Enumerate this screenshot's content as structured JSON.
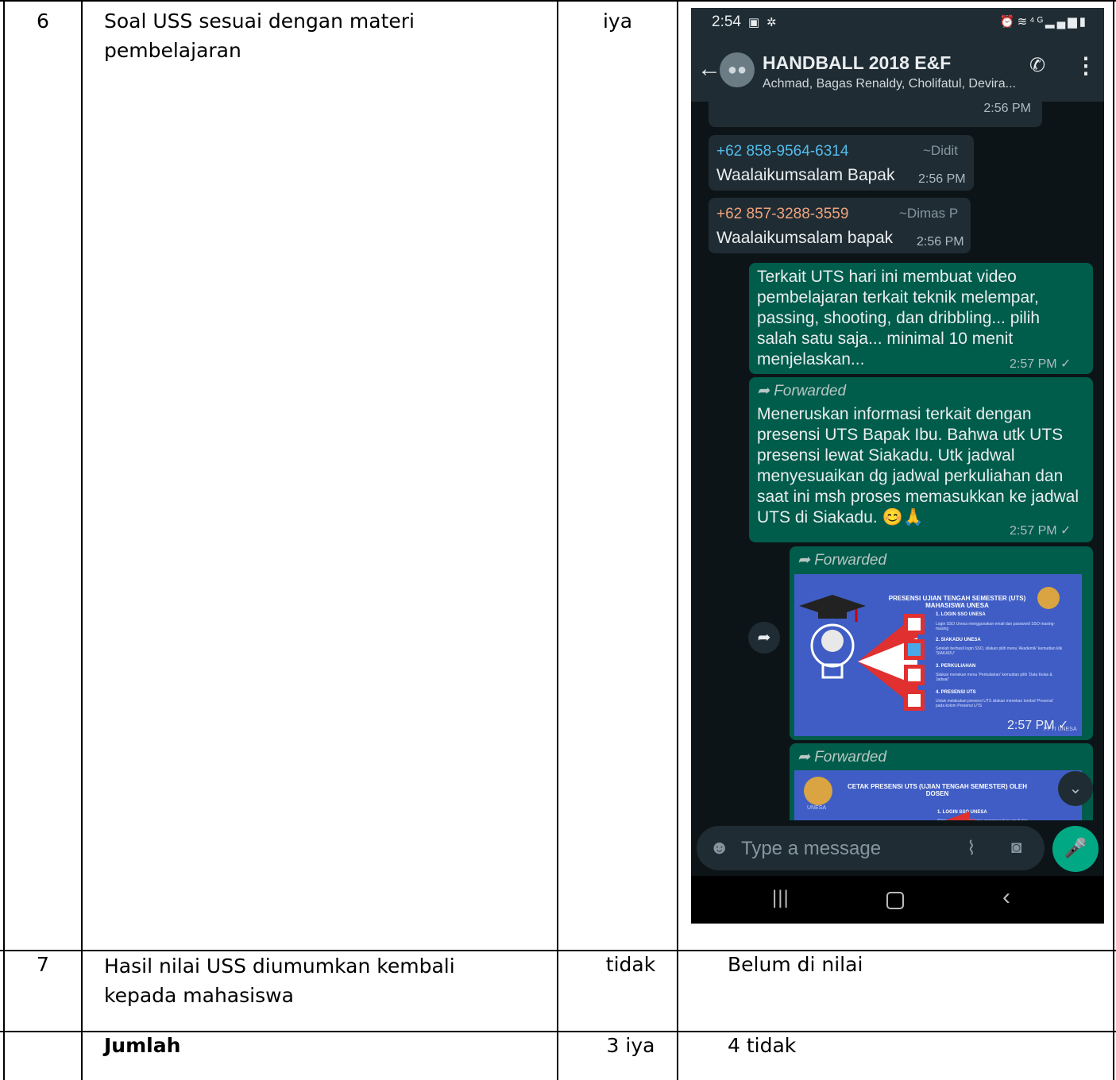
{
  "table": {
    "rows": [
      {
        "no": "6",
        "item": "Soal USS sesuai dengan materi pembelajaran",
        "status": "iya",
        "note": ""
      },
      {
        "no": "7",
        "item": "Hasil nilai USS diumumkan kembali kepada mahasiswa",
        "status": "tidak",
        "note": "Belum di nilai"
      },
      {
        "no": "",
        "item": "Jumlah",
        "status": "3 iya",
        "note": "4 tidak"
      }
    ]
  },
  "phone": {
    "status_bar": {
      "time": "2:54",
      "icons": [
        "gallery-icon",
        "gear-icon",
        "alarm-icon",
        "wifi-icon",
        "4g-icon",
        "signal-icon",
        "battery-icon"
      ]
    },
    "chat_header": {
      "group_name": "HANDBALL 2018 E&F",
      "members": "Achmad, Bagas Renaldy, Cholifatul, Devira..."
    },
    "messages": [
      {
        "type": "in",
        "time": "2:56 PM"
      },
      {
        "type": "in",
        "sender": "+62 858-9564-6314",
        "alias": "~Didit",
        "text": "Waalaikumsalam Bapak",
        "time": "2:56 PM",
        "sender_color": "#53bdeb"
      },
      {
        "type": "in",
        "sender": "+62 857-3288-3559",
        "alias": "~Dimas P",
        "text": "Waalaikumsalam bapak",
        "time": "2:56 PM",
        "sender_color": "#f0a37d"
      },
      {
        "type": "out",
        "text": "Terkait UTS hari ini membuat video pembelajaran terkait teknik melempar, passing, shooting, dan dribbling... pilih salah satu saja... minimal 10 menit menjelaskan...",
        "time": "2:57 PM ✓"
      },
      {
        "type": "out",
        "forwarded": "Forwarded",
        "text": "Meneruskan informasi terkait dengan presensi UTS Bapak Ibu. Bahwa utk UTS presensi lewat Siakadu. Utk jadwal menyesuaikan dg jadwal perkuliahan dan saat ini msh proses memasukkan ke jadwal UTS di Siakadu. 😊🙏",
        "time": "2:57 PM ✓"
      },
      {
        "type": "out-image",
        "forwarded": "Forwarded",
        "time": "2:57 PM ✓",
        "poster": {
          "title": "PRESENSI UJIAN TENGAH SEMESTER (UTS) MAHASISWA UNESA",
          "items": [
            {
              "heading": "1. LOGIN SSO UNESA",
              "desc": "Login SSO Unesa menggunakan email dan password SSO masing-masing"
            },
            {
              "heading": "2. SIAKADU UNESA",
              "desc": "Setelah berhasil login SSO, silakan pilih menu 'Akademik' kemudian klik 'SIAKADU'"
            },
            {
              "heading": "3. PERKULIAHAN",
              "desc": "Silakan menekan menu 'Perkuliahan' kemudian pilih 'Data Kelas & Jadwal'"
            },
            {
              "heading": "4. PRESENSI UTS",
              "desc": "Untuk melakukan presensi UTS silakan menekan tombol 'Presensi' pada kolom Presensi UTS"
            }
          ],
          "footer": "PPTI UNESA"
        }
      },
      {
        "type": "out-image",
        "forwarded": "Forwarded",
        "poster": {
          "title": "CETAK PRESENSI UTS (UJIAN TENGAH SEMESTER) OLEH DOSEN",
          "items": [
            {
              "heading": "1. LOGIN SSO UNESA",
              "desc": "Silakan Login SSO Unesa menggunakan email dan"
            }
          ],
          "logo_text": "UNESA"
        }
      }
    ],
    "input": {
      "placeholder": "Type a message"
    },
    "colors": {
      "header": "#1f2c34",
      "outgoing": "#005c4b",
      "incoming": "#1f2c34",
      "accent": "#00a884"
    }
  }
}
